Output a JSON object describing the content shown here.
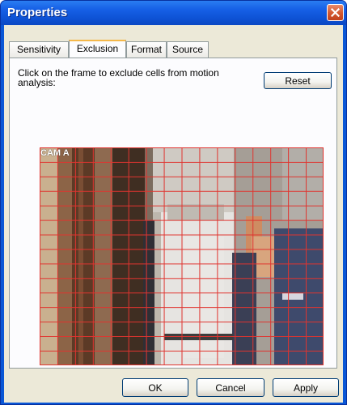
{
  "window": {
    "title": "Properties"
  },
  "tabs": [
    {
      "label": "Sensitivity",
      "active": false
    },
    {
      "label": "Exclusion",
      "active": true
    },
    {
      "label": "Format",
      "active": false
    },
    {
      "label": "Source",
      "active": false
    }
  ],
  "exclusion": {
    "instruction": "Click on the frame to exclude cells from motion analysis:",
    "reset_label": "Reset",
    "camera_label": "CAM A",
    "grid_columns": 16,
    "grid_rows": 15
  },
  "footer": {
    "ok_label": "OK",
    "cancel_label": "Cancel",
    "apply_label": "Apply"
  },
  "colors": {
    "grid_line": "#e0342f",
    "title_bar": "#0a57d6",
    "dialog_bg": "#ece9d8"
  }
}
